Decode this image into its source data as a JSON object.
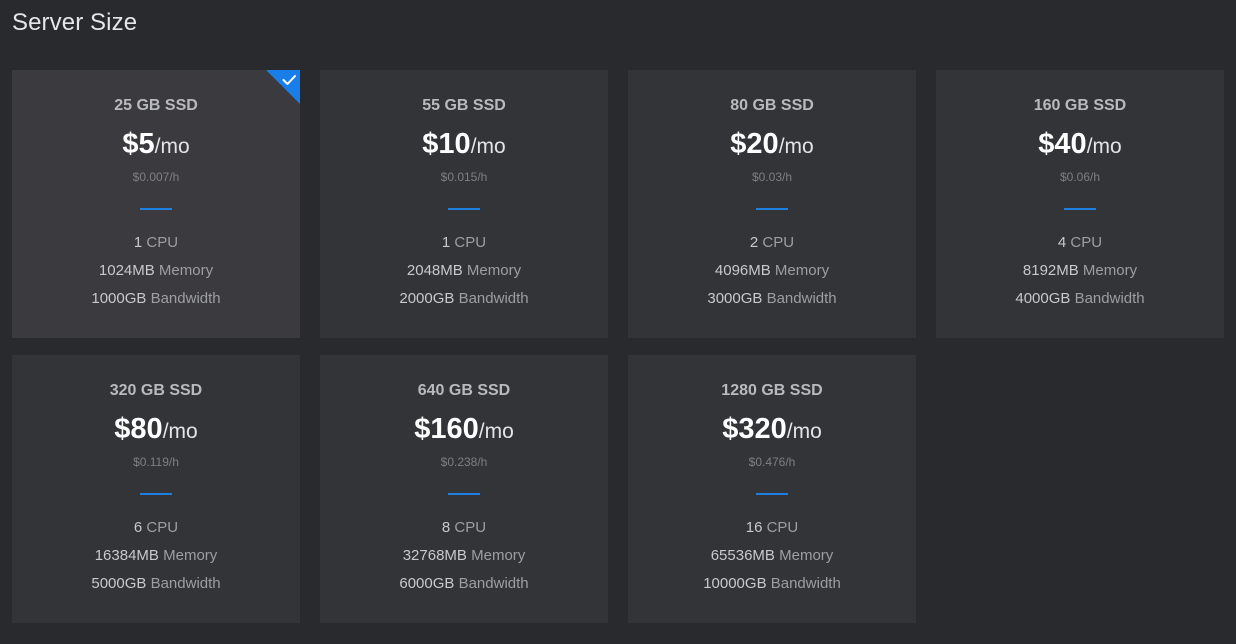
{
  "page": {
    "title": "Server Size"
  },
  "plans": [
    {
      "storage": "25 GB SSD",
      "price": "$5",
      "per": "/mo",
      "hourly": "$0.007/h",
      "cpu": "1",
      "cpu_label": " CPU",
      "memory": "1024MB",
      "memory_label": " Memory",
      "bandwidth": "1000GB",
      "bandwidth_label": " Bandwidth",
      "selected": true
    },
    {
      "storage": "55 GB SSD",
      "price": "$10",
      "per": "/mo",
      "hourly": "$0.015/h",
      "cpu": "1",
      "cpu_label": " CPU",
      "memory": "2048MB",
      "memory_label": " Memory",
      "bandwidth": "2000GB",
      "bandwidth_label": " Bandwidth",
      "selected": false
    },
    {
      "storage": "80 GB SSD",
      "price": "$20",
      "per": "/mo",
      "hourly": "$0.03/h",
      "cpu": "2",
      "cpu_label": " CPU",
      "memory": "4096MB",
      "memory_label": " Memory",
      "bandwidth": "3000GB",
      "bandwidth_label": " Bandwidth",
      "selected": false
    },
    {
      "storage": "160 GB SSD",
      "price": "$40",
      "per": "/mo",
      "hourly": "$0.06/h",
      "cpu": "4",
      "cpu_label": " CPU",
      "memory": "8192MB",
      "memory_label": " Memory",
      "bandwidth": "4000GB",
      "bandwidth_label": " Bandwidth",
      "selected": false
    },
    {
      "storage": "320 GB SSD",
      "price": "$80",
      "per": "/mo",
      "hourly": "$0.119/h",
      "cpu": "6",
      "cpu_label": " CPU",
      "memory": "16384MB",
      "memory_label": " Memory",
      "bandwidth": "5000GB",
      "bandwidth_label": " Bandwidth",
      "selected": false
    },
    {
      "storage": "640 GB SSD",
      "price": "$160",
      "per": "/mo",
      "hourly": "$0.238/h",
      "cpu": "8",
      "cpu_label": " CPU",
      "memory": "32768MB",
      "memory_label": " Memory",
      "bandwidth": "6000GB",
      "bandwidth_label": " Bandwidth",
      "selected": false
    },
    {
      "storage": "1280 GB SSD",
      "price": "$320",
      "per": "/mo",
      "hourly": "$0.476/h",
      "cpu": "16",
      "cpu_label": " CPU",
      "memory": "65536MB",
      "memory_label": " Memory",
      "bandwidth": "10000GB",
      "bandwidth_label": " Bandwidth",
      "selected": false
    }
  ],
  "colors": {
    "background": "#292a2e",
    "card": "#333438",
    "card_selected": "#3b3b3f",
    "accent": "#1f7fe0",
    "selected_badge": "#1a7ee8"
  },
  "icons": {
    "selected_badge": "checkmark-icon"
  }
}
